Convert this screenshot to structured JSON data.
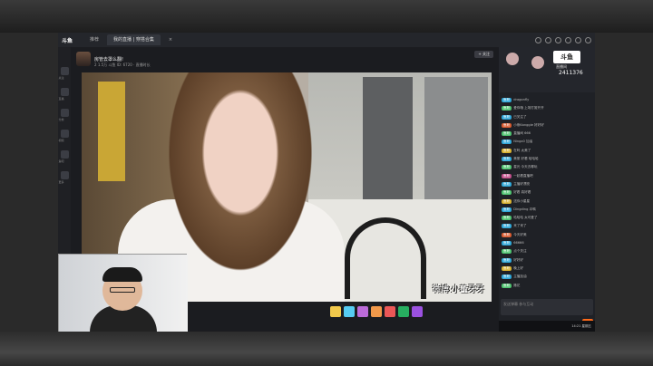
{
  "titlebar": {
    "logo": "斗鱼",
    "tabs": [
      "推荐",
      "我的直播 | 穿搭合集"
    ],
    "tab_close": "×"
  },
  "sidebar": {
    "items": [
      "关注",
      "直播",
      "分类",
      "视频",
      "鱼吧",
      "更多"
    ]
  },
  "stream": {
    "title": "房管去罩么翻!",
    "meta": "2 1.5万  斗鱼 ID: 6720  · 直播时长",
    "follow": "+ 关注",
    "watermark": "微博:小董牙牙"
  },
  "rightpanel": {
    "logo": "斗鱼",
    "logo_sub": "直播间",
    "viewer_count": "2411376",
    "chat": [
      {
        "name": "鱼粉",
        "text": "dragonfly",
        "color": "#2fa7d8"
      },
      {
        "name": "鱼粉",
        "text": "爱你哦 上场打赏开开",
        "color": "#4ec26f"
      },
      {
        "name": "鱼粉",
        "text": "已关注了",
        "color": "#2fa7d8"
      },
      {
        "name": "鱼粉",
        "text": "小熊Kanggie 好好好",
        "color": "#d85a2f"
      },
      {
        "name": "鱼粉",
        "text": "直播间 666",
        "color": "#4ec26f"
      },
      {
        "name": "鱼粉",
        "text": "Ningx0 加油",
        "color": "#2fa7d8"
      },
      {
        "name": "鱼粉",
        "text": "在吗 太美了",
        "color": "#d8b12f"
      },
      {
        "name": "鱼粉",
        "text": "美丽 好看 哈哈哈",
        "color": "#2fa7d8"
      },
      {
        "name": "鱼粉",
        "text": "星光 今天去哪玩",
        "color": "#4ec26f"
      },
      {
        "name": "鱼粉",
        "text": "一起看直播吧",
        "color": "#c24e8a"
      },
      {
        "name": "鱼粉",
        "text": "主播好漂亮",
        "color": "#2fa7d8"
      },
      {
        "name": "鱼粉",
        "text": "好看 真好看",
        "color": "#4ec26f"
      },
      {
        "name": "鱼粉",
        "text": "送你小星星",
        "color": "#d8b12f"
      },
      {
        "name": "鱼粉",
        "text": "Dingding 冲鸭",
        "color": "#2fa7d8"
      },
      {
        "name": "鱼粉",
        "text": "哈哈哈 太可爱了",
        "color": "#4ec26f"
      },
      {
        "name": "鱼粉",
        "text": "来了来了",
        "color": "#2fa7d8"
      },
      {
        "name": "鱼粉",
        "text": "今天好美",
        "color": "#d85a2f"
      },
      {
        "name": "鱼粉",
        "text": "66666",
        "color": "#2fa7d8"
      },
      {
        "name": "鱼粉",
        "text": "点个关注",
        "color": "#4ec26f"
      },
      {
        "name": "鱼粉",
        "text": "好好好",
        "color": "#2fa7d8"
      },
      {
        "name": "鱼粉",
        "text": "晚上好",
        "color": "#d8b12f"
      },
      {
        "name": "鱼粉",
        "text": "主播加油",
        "color": "#2fa7d8"
      },
      {
        "name": "鱼粉",
        "text": "撒花",
        "color": "#4ec26f"
      }
    ],
    "input_placeholder": "发送弹幕 参与互动",
    "send_label": "发送",
    "clock": "14:21 星期五"
  }
}
